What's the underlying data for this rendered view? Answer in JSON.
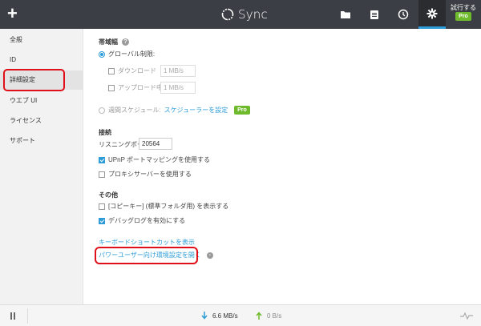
{
  "app": {
    "title": "Sync"
  },
  "header": {
    "trial_label": "試行する",
    "pro_label": "Pro"
  },
  "sidebar": {
    "items": [
      {
        "label": "全般"
      },
      {
        "label": "ID"
      },
      {
        "label": "詳細設定"
      },
      {
        "label": "ウエブ UI"
      },
      {
        "label": "ライセンス"
      },
      {
        "label": "サポート"
      }
    ]
  },
  "bandwidth": {
    "title": "帯域幅",
    "global_limit": "グローバル制限:",
    "download_label": "ダウンロード",
    "download_value": "1 MB/s",
    "upload_label": "アップロード中",
    "upload_value": "1 MB/s",
    "schedule_label": "週間スケジュール:",
    "schedule_link": "スケジューラーを設定",
    "pro_label": "Pro"
  },
  "connection": {
    "title": "接続",
    "port_label": "リスニングポート:",
    "port_value": "20564",
    "upnp_label": "UPnP ポートマッピングを使用する",
    "proxy_label": "プロキシサーバーを使用する"
  },
  "other": {
    "title": "その他",
    "copy_label": "[コピーキー] (標準フォルダ用) を表示する",
    "debug_label": "デバッグログを有効にする"
  },
  "links": {
    "shortcuts": "キーボードショートカットを表示",
    "power_user": "パワーユーザー向け環境設定を開く"
  },
  "status": {
    "download_speed": "6.6 MB/s",
    "upload_speed": "0 B/s"
  },
  "colors": {
    "topbar": "#3b3e44",
    "accent": "#2d9cd8",
    "pro": "#6fba2c",
    "highlight": "#e0101a"
  }
}
